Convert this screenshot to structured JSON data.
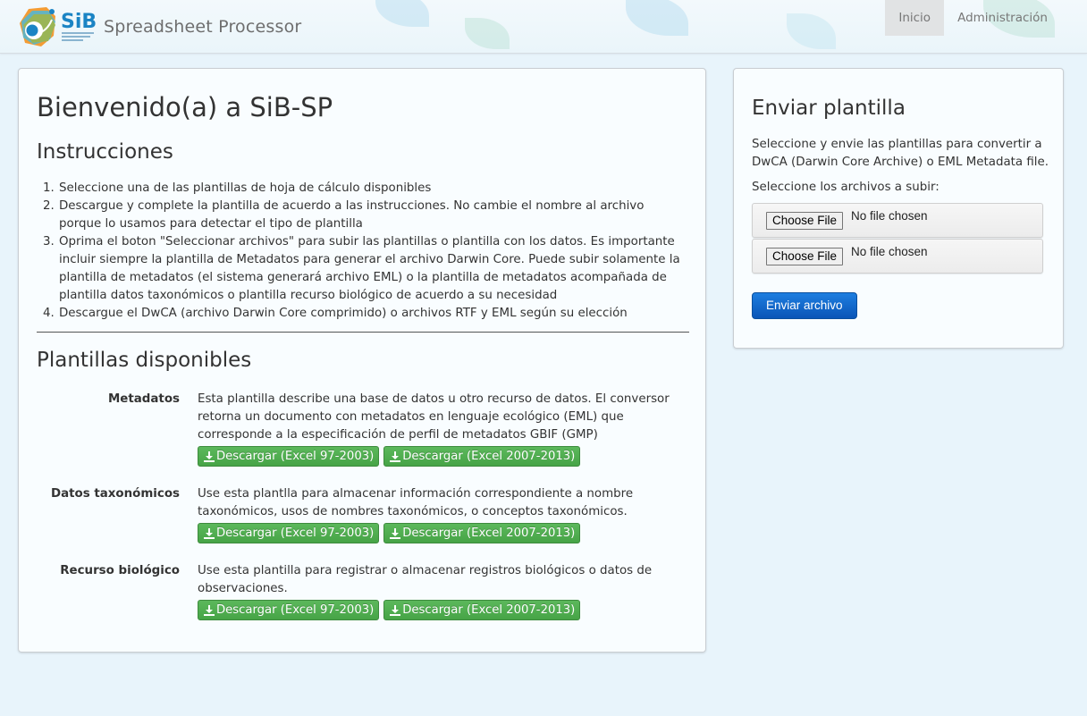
{
  "navbar": {
    "logo_text": "SiB",
    "app_title": "Spreadsheet Processor",
    "items": [
      {
        "label": "Inicio",
        "active": true
      },
      {
        "label": "Administración",
        "active": false
      }
    ]
  },
  "main": {
    "title": "Bienvenido(a) a SiB-SP",
    "instructions_title": "Instrucciones",
    "instructions": [
      "Seleccione una de las plantillas de hoja de cálculo disponibles",
      "Descargue y complete la plantilla de acuerdo a las instrucciones. No cambie el nombre al archivo porque lo usamos para detectar el tipo de plantilla",
      "Oprima el boton \"Seleccionar archivos\" para subir las plantillas o plantilla con los datos. Es importante incluir siempre la plantilla de Metadatos para generar el archivo Darwin Core. Puede subir solamente la plantilla de metadatos (el sistema generará archivo EML) o la plantilla de metadatos acompañada de plantilla datos taxonómicos o plantilla recurso biológico de acuerdo a su necesidad",
      "Descargue el DwCA (archivo Darwin Core comprimido) o archivos RTF y EML según su elección"
    ],
    "templates_title": "Plantillas disponibles",
    "templates": [
      {
        "name": "Metadatos",
        "description": "Esta plantilla describe una base de datos u otro recurso de datos. El conversor retorna un documento con metadatos en lenguaje ecológico (EML) que corresponde a la especificación de perfil de metadatos GBIF (GMP)",
        "download_xls": "Descargar (Excel 97-2003)",
        "download_xlsx": "Descargar (Excel 2007-2013)"
      },
      {
        "name": "Datos taxonómicos",
        "description": "Use esta plantlla para almacenar información correspondiente a nombre taxonómicos, usos de nombres taxonómicos, o conceptos taxonómicos.",
        "download_xls": "Descargar (Excel 97-2003)",
        "download_xlsx": "Descargar (Excel 2007-2013)"
      },
      {
        "name": "Recurso biológico",
        "description": "Use esta plantilla para registrar o almacenar registros biológicos o datos de observaciones.",
        "download_xls": "Descargar (Excel 97-2003)",
        "download_xlsx": "Descargar (Excel 2007-2013)"
      }
    ]
  },
  "sidebar": {
    "title": "Enviar plantilla",
    "description": "Seleccione y envie las plantillas para convertir a DwCA (Darwin Core Archive) o EML Metadata file.",
    "files_label": "Seleccione los archivos a subir:",
    "file_inputs": [
      {
        "button": "Choose File",
        "status": "No file chosen"
      },
      {
        "button": "Choose File",
        "status": "No file chosen"
      }
    ],
    "submit_label": "Enviar archivo"
  },
  "colors": {
    "download_button": "#5cb85c",
    "submit_button": "#1565c9",
    "nav_active_bg": "#e1e3e4"
  }
}
